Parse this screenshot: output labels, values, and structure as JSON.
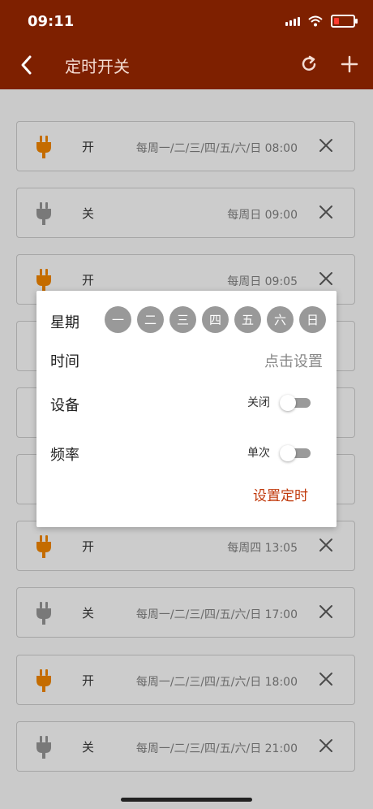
{
  "status": {
    "time": "09:11"
  },
  "nav": {
    "title": "定时开关"
  },
  "colors": {
    "accent": "#7e2000",
    "plug_on": "#e07b00",
    "plug_off": "#8a8a8a",
    "submit": "#c0390b"
  },
  "rows": [
    {
      "state": "开",
      "schedule": "每周一/二/三/四/五/六/日 08:00",
      "on": true
    },
    {
      "state": "关",
      "schedule": "每周日 09:00",
      "on": false
    },
    {
      "state": "开",
      "schedule": "每周日 09:05",
      "on": true
    },
    {
      "state": "",
      "schedule": "",
      "on": true
    },
    {
      "state": "",
      "schedule": "",
      "on": false
    },
    {
      "state": "",
      "schedule": "",
      "on": true
    },
    {
      "state": "开",
      "schedule": "每周四 13:05",
      "on": true
    },
    {
      "state": "关",
      "schedule": "每周一/二/三/四/五/六/日 17:00",
      "on": false
    },
    {
      "state": "开",
      "schedule": "每周一/二/三/四/五/六/日 18:00",
      "on": true
    },
    {
      "state": "关",
      "schedule": "每周一/二/三/四/五/六/日 21:00",
      "on": false
    }
  ],
  "dialog": {
    "week_label": "星期",
    "days": [
      "一",
      "二",
      "三",
      "四",
      "五",
      "六",
      "日"
    ],
    "time_label": "时间",
    "time_value": "点击设置",
    "device_label": "设备",
    "device_value": "关闭",
    "frequency_label": "频率",
    "frequency_value": "单次",
    "submit_label": "设置定时"
  }
}
